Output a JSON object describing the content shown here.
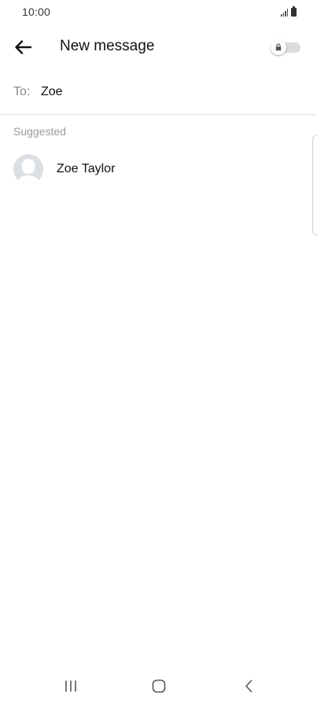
{
  "status_bar": {
    "time": "10:00",
    "icons": [
      "signal-icon",
      "battery-icon"
    ]
  },
  "app_bar": {
    "back_icon": "arrow-left-icon",
    "title": "New message",
    "lock_toggle": {
      "icon": "lock-icon",
      "state": "off"
    }
  },
  "recipient": {
    "label": "To:",
    "value": "Zoe",
    "placeholder": ""
  },
  "suggested": {
    "header": "Suggested",
    "contacts": [
      {
        "name": "Zoe Taylor",
        "avatar": "default-person-avatar"
      }
    ]
  },
  "nav_bar": {
    "buttons": [
      "recents-icon",
      "home-icon",
      "back-chevron-icon"
    ]
  },
  "colors": {
    "background": "#ffffff",
    "text_primary": "#111111",
    "text_secondary": "#8a8a8a",
    "avatar_bg": "#dcdfe3",
    "toggle_track": "#dcdcdc"
  }
}
